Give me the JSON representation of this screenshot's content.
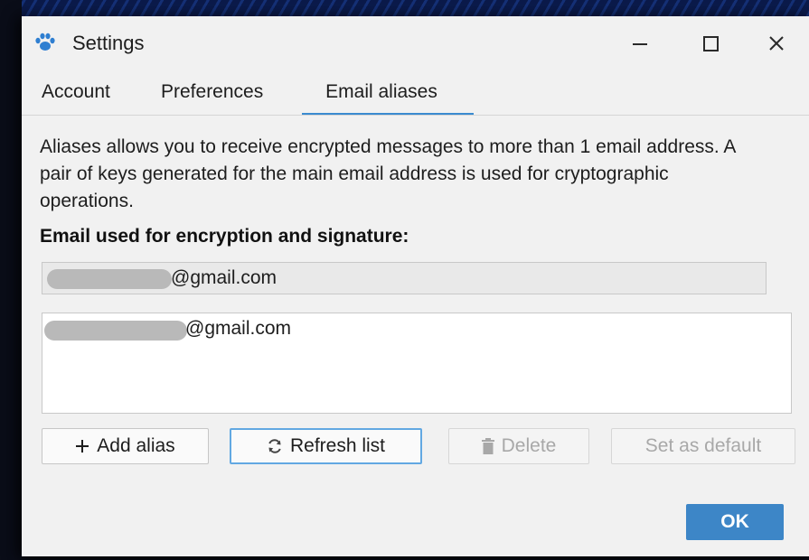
{
  "window": {
    "title": "Settings",
    "app_icon": "paw-icon",
    "controls": [
      "minimize-icon",
      "maximize-icon",
      "close-icon"
    ]
  },
  "tabs": [
    {
      "label": "Account",
      "selected": false
    },
    {
      "label": "Preferences",
      "selected": false
    },
    {
      "label": "Email aliases",
      "selected": true
    }
  ],
  "description": "Aliases allows you to receive encrypted messages to more than 1 email address. A pair of keys generated for the main email address is used for cryptographic operations.",
  "section_heading": "Email used for encryption and signature:",
  "main_email": {
    "visible_text": "@gmail.com",
    "redacted_prefix": true
  },
  "aliases": [
    {
      "visible_text": "@gmail.com",
      "redacted_prefix": true
    }
  ],
  "buttons": {
    "add_alias": {
      "label": "Add alias",
      "icon": "plus-icon",
      "enabled": true
    },
    "refresh_list": {
      "label": "Refresh list",
      "icon": "refresh-icon",
      "enabled": true,
      "focused": true
    },
    "delete": {
      "label": "Delete",
      "icon": "trash-icon",
      "enabled": false
    },
    "set_default": {
      "label": "Set as default",
      "enabled": false
    },
    "ok": {
      "label": "OK"
    }
  },
  "colors": {
    "accent": "#3a8bd0",
    "ok_button": "#3d86c7",
    "app_icon": "#2f7fd1",
    "disabled_text": "#a8a8a8"
  }
}
